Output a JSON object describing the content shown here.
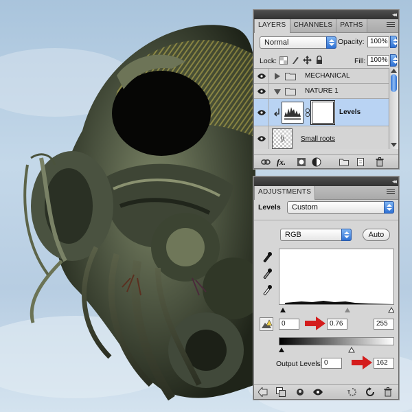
{
  "layers_panel": {
    "tabs": [
      "LAYERS",
      "CHANNELS",
      "PATHS"
    ],
    "blend_mode": "Normal",
    "opacity_label": "Opacity:",
    "opacity_value": "100%",
    "lock_label": "Lock:",
    "fill_label": "Fill:",
    "fill_value": "100%",
    "layers": [
      {
        "name": "MECHANICAL",
        "type": "group",
        "expanded": false
      },
      {
        "name": "NATURE 1",
        "type": "group",
        "expanded": true
      },
      {
        "name": "Levels",
        "type": "adjustment",
        "selected": true
      },
      {
        "name": "Small roots",
        "type": "layer"
      }
    ],
    "bottom_icons": [
      "link-icon",
      "fx-icon",
      "mask-icon",
      "adjustment-icon",
      "folder-icon",
      "new-layer-icon",
      "trash-icon"
    ]
  },
  "adjustments_panel": {
    "tab": "ADJUSTMENTS",
    "preset_label": "Levels",
    "preset_value": "Custom",
    "channel_value": "RGB",
    "auto_label": "Auto",
    "input_black": "0",
    "input_gamma": "0.76",
    "input_white": "255",
    "output_label": "Output Levels:",
    "output_black": "0",
    "output_white": "162",
    "bottom_icons": [
      "back-icon",
      "clip-icon",
      "eye-toggle-icon",
      "visibility-icon",
      "previous-state-icon",
      "reset-icon",
      "trash-icon"
    ]
  },
  "colors": {
    "highlight_arrow": "#d41c1c",
    "selected_row": "#b9d3f3",
    "dropdown_accent": "#2f71d4"
  }
}
